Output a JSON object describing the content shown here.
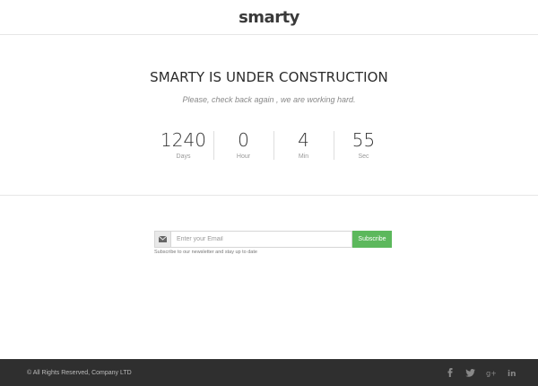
{
  "header": {
    "logo": "smarty"
  },
  "hero": {
    "title": "SMARTY IS UNDER CONSTRUCTION",
    "subtitle": "Please, check back again , we are working hard."
  },
  "countdown": [
    {
      "value": "1240",
      "label": "Days"
    },
    {
      "value": "0",
      "label": "Hour"
    },
    {
      "value": "4",
      "label": "Min"
    },
    {
      "value": "55",
      "label": "Sec"
    }
  ],
  "subscribe": {
    "icon": "envelope-icon",
    "placeholder": "Enter your Email",
    "button": "Subscribe",
    "note": "Subscribe to our newsletter and stay up to date"
  },
  "footer": {
    "copyright": "© All Rights Reserved, Company LTD",
    "social": [
      "facebook-icon",
      "twitter-icon",
      "google-plus-icon",
      "linkedin-icon"
    ]
  },
  "colors": {
    "accent": "#5cb85c",
    "footer_bg": "#2f2f2f",
    "text": "#333333"
  }
}
